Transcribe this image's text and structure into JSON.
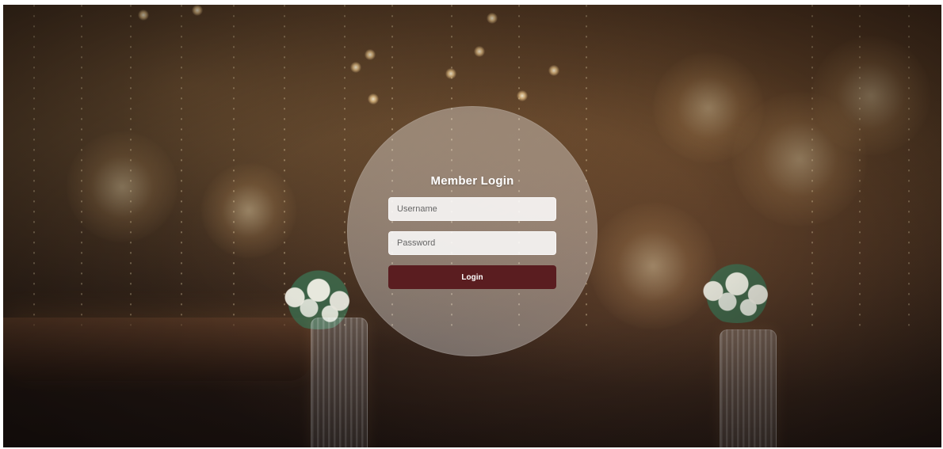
{
  "login": {
    "title": "Member Login",
    "username_placeholder": "Username",
    "password_placeholder": "Password",
    "button_label": "Login"
  },
  "colors": {
    "login_button": "#5a1d20",
    "circle_overlay": "rgba(255,255,255,0.34)"
  }
}
